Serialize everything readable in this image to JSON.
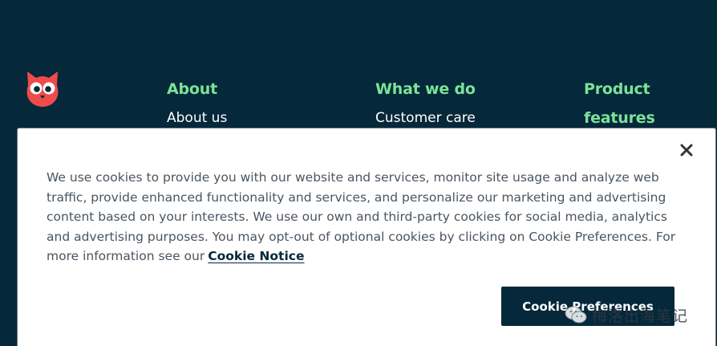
{
  "footer": {
    "columns": [
      {
        "heading": "About",
        "links": [
          "About us"
        ]
      },
      {
        "heading": "What we do",
        "links": [
          "Customer care"
        ]
      },
      {
        "heading": "Product features",
        "links": []
      }
    ]
  },
  "cookie_banner": {
    "body_text": "We use cookies to provide you with our website and services, monitor site usage and analyze web traffic, provide enhanced functionality and services, and personalize our marketing and advertising content based on your interests. We use our own and third-party cookies for social media, analytics and advertising purposes. You may opt-out of optional cookies by clicking on Cookie Preferences. For more information see our",
    "notice_link": "Cookie Notice",
    "preferences_button": "Cookie Preferences",
    "close_icon": "close-icon"
  },
  "watermark": {
    "text": "梅洛出海笔记",
    "icon": "wechat-icon"
  },
  "colors": {
    "background": "#05283a",
    "heading_accent": "#7ce398",
    "logo_red": "#ef4b4b"
  }
}
